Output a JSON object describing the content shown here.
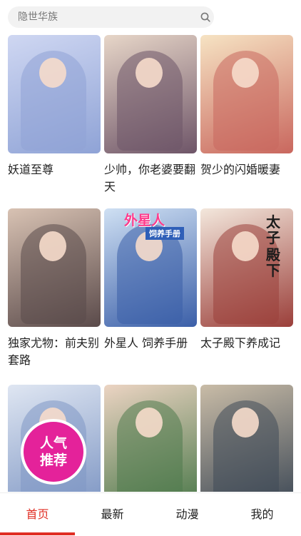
{
  "search": {
    "placeholder": "隐世华族"
  },
  "comics": [
    {
      "title": "妖道至尊",
      "palette": [
        "#cfd7f2",
        "#8fa3d6"
      ]
    },
    {
      "title": "少帅，你老婆要翻天",
      "palette": [
        "#e7d6c8",
        "#6e5568"
      ]
    },
    {
      "title": "贺少的闪婚暖妻",
      "palette": [
        "#f6e3c3",
        "#c9675e"
      ]
    },
    {
      "title": "独家尤物：前夫别套路",
      "palette": [
        "#d8c2b3",
        "#5a4a4a"
      ]
    },
    {
      "title": "外星人 饲养手册",
      "palette": [
        "#cfe0f3",
        "#3b5fa8"
      ],
      "cover_text": [
        "外星人",
        "饲养手册"
      ]
    },
    {
      "title": "太子殿下养成记",
      "palette": [
        "#f3e7dc",
        "#9b3f3a"
      ],
      "cover_text": [
        "太子",
        "殿下"
      ]
    },
    {
      "title": "",
      "palette": [
        "#dfe6f2",
        "#7f97c4"
      ],
      "badge": [
        "人气",
        "推荐"
      ]
    },
    {
      "title": "",
      "palette": [
        "#ecd4c3",
        "#4e7a4c"
      ]
    },
    {
      "title": "",
      "palette": [
        "#c9bca7",
        "#3f4a57"
      ]
    }
  ],
  "tabs": [
    {
      "label": "首页",
      "active": true
    },
    {
      "label": "最新",
      "active": false
    },
    {
      "label": "动漫",
      "active": false
    },
    {
      "label": "我的",
      "active": false
    }
  ],
  "colors": {
    "accent": "#e02e24",
    "search_bg": "#f2f2f2"
  }
}
